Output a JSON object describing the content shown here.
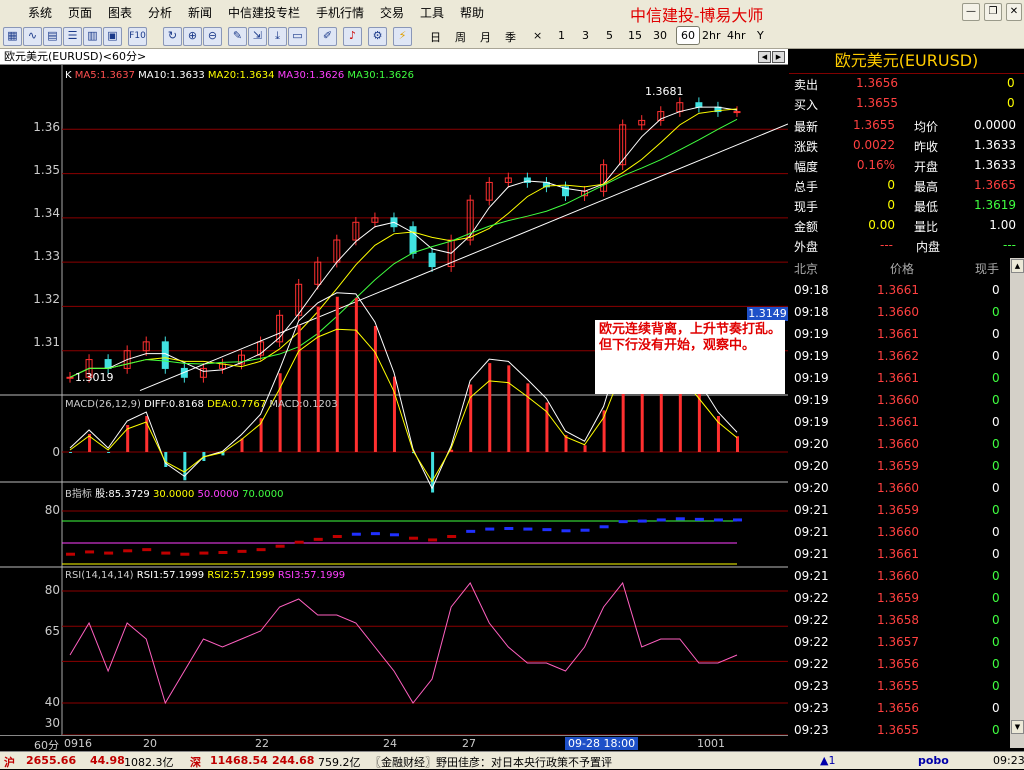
{
  "menu": [
    "系统",
    "页面",
    "图表",
    "分析",
    "新闻",
    "中信建投专栏",
    "手机行情",
    "交易",
    "工具",
    "帮助"
  ],
  "brand": "中信建投-博易大师",
  "periods": [
    "日",
    "周",
    "月",
    "季",
    "×",
    "1",
    "3",
    "5",
    "15",
    "30",
    "60",
    "2hr",
    "4hr",
    "Y"
  ],
  "selected_period": "60",
  "chart": {
    "title": "欧元美元(EURUSD)<60分>",
    "price_tag": "1.3149",
    "max_label": "1.3681",
    "min_label": "1.3019",
    "ma_legend": [
      {
        "text": "K",
        "color": "#ffffff"
      },
      {
        "text": "MA5:1.3637",
        "color": "#ff5050"
      },
      {
        "text": "MA10:1.3633",
        "color": "#ffffff"
      },
      {
        "text": "MA20:1.3634",
        "color": "#ffff00"
      },
      {
        "text": "MA30:1.3626",
        "color": "#ff40ff"
      },
      {
        "text": "MA30:1.3626",
        "color": "#40ff40"
      }
    ],
    "macd_legend": [
      {
        "text": "MACD(26,12,9)",
        "color": "#cccccc"
      },
      {
        "text": "DIFF:0.8168",
        "color": "#ffffff"
      },
      {
        "text": "DEA:0.7767",
        "color": "#ffff00"
      },
      {
        "text": "MACD:0.1203",
        "color": "#cccccc"
      }
    ],
    "b_legend": [
      {
        "text": "B指标",
        "color": "#cccccc"
      },
      {
        "text": "股:85.3729",
        "color": "#ffffff"
      },
      {
        "text": "30.0000",
        "color": "#ffff00"
      },
      {
        "text": "50.0000",
        "color": "#ff40ff"
      },
      {
        "text": "70.0000",
        "color": "#40ff40"
      }
    ],
    "rsi_legend": [
      {
        "text": "RSI(14,14,14)",
        "color": "#cccccc"
      },
      {
        "text": "RSI1:57.1999",
        "color": "#ffffff"
      },
      {
        "text": "RSI2:57.1999",
        "color": "#ffff00"
      },
      {
        "text": "RSI3:57.1999",
        "color": "#ff40ff"
      }
    ],
    "price_axis": [
      "1.36",
      "1.35",
      "1.34",
      "1.33",
      "1.32",
      "1.31"
    ],
    "macd_axis": [
      "0"
    ],
    "b_axis": [
      "80"
    ],
    "rsi_axis": [
      "80",
      "65",
      "40",
      "30"
    ],
    "note": "欧元连续背离，上升节奏打乱。但下行没有开始，观察中。",
    "x_axis": {
      "period": "60分",
      "labels": [
        "0916",
        "20",
        "22",
        "24",
        "27",
        "1001"
      ],
      "cursor": "09-28 18:00"
    }
  },
  "chart_data": {
    "type": "candlestick",
    "title": "欧元美元(EURUSD)<60分>",
    "ylim": [
      1.3,
      1.37
    ],
    "x_labels": [
      "0916",
      "20",
      "22",
      "24",
      "27",
      "1001"
    ],
    "close": [
      1.304,
      1.308,
      1.306,
      1.31,
      1.312,
      1.306,
      1.304,
      1.306,
      1.307,
      1.309,
      1.312,
      1.318,
      1.325,
      1.33,
      1.335,
      1.339,
      1.34,
      1.338,
      1.332,
      1.329,
      1.335,
      1.344,
      1.348,
      1.349,
      1.348,
      1.347,
      1.345,
      1.346,
      1.352,
      1.361,
      1.362,
      1.364,
      1.366,
      1.365,
      1.364,
      1.364
    ],
    "trendline": [
      [
        1.3019,
        1.37
      ]
    ],
    "series": [
      {
        "name": "MA5",
        "last": 1.3637
      },
      {
        "name": "MA10",
        "last": 1.3633
      },
      {
        "name": "MA20",
        "last": 1.3634
      },
      {
        "name": "MA30",
        "last": 1.3626
      }
    ],
    "macd": {
      "DIFF": 0.8168,
      "DEA": 0.7767,
      "MACD": 0.1203
    },
    "b_indicator": {
      "股": 85.3729,
      "levels": [
        30,
        50,
        70
      ]
    },
    "rsi": {
      "RSI1": 57.1999,
      "RSI2": 57.1999,
      "RSI3": 57.1999
    }
  },
  "quote": {
    "title": "欧元美元(EURUSD)",
    "sell": {
      "label": "卖出",
      "price": "1.3656",
      "qty": "0"
    },
    "buy": {
      "label": "买入",
      "price": "1.3655",
      "qty": "0"
    },
    "fields": [
      {
        "l1": "最新",
        "v1": "1.3655",
        "c1": "#ff4040",
        "l2": "均价",
        "v2": "0.0000",
        "c2": "#ffffff"
      },
      {
        "l1": "涨跌",
        "v1": "0.0022",
        "c1": "#ff4040",
        "l2": "昨收",
        "v2": "1.3633",
        "c2": "#ffffff"
      },
      {
        "l1": "幅度",
        "v1": "0.16%",
        "c1": "#ff4040",
        "l2": "开盘",
        "v2": "1.3633",
        "c2": "#ffffff"
      },
      {
        "l1": "总手",
        "v1": "0",
        "c1": "#ffff00",
        "l2": "最高",
        "v2": "1.3665",
        "c2": "#ff4040"
      },
      {
        "l1": "现手",
        "v1": "0",
        "c1": "#ffff00",
        "l2": "最低",
        "v2": "1.3619",
        "c2": "#40ff40"
      },
      {
        "l1": "金额",
        "v1": "0.00",
        "c1": "#ffff00",
        "l2": "量比",
        "v2": "1.00",
        "c2": "#ffffff"
      }
    ],
    "outer": {
      "label": "外盘",
      "value": "---"
    },
    "inner": {
      "label": "内盘",
      "value": "---"
    },
    "trade_headers": [
      "北京",
      "价格",
      "现手"
    ],
    "trades": [
      {
        "time": "09:18",
        "price": "1.3661",
        "qty": "0",
        "qc": "#ffffff"
      },
      {
        "time": "09:18",
        "price": "1.3660",
        "qty": "0",
        "qc": "#40ff40"
      },
      {
        "time": "09:19",
        "price": "1.3661",
        "qty": "0",
        "qc": "#ffffff"
      },
      {
        "time": "09:19",
        "price": "1.3662",
        "qty": "0",
        "qc": "#ffffff"
      },
      {
        "time": "09:19",
        "price": "1.3661",
        "qty": "0",
        "qc": "#40ff40"
      },
      {
        "time": "09:19",
        "price": "1.3660",
        "qty": "0",
        "qc": "#40ff40"
      },
      {
        "time": "09:19",
        "price": "1.3661",
        "qty": "0",
        "qc": "#ffffff"
      },
      {
        "time": "09:20",
        "price": "1.3660",
        "qty": "0",
        "qc": "#40ff40"
      },
      {
        "time": "09:20",
        "price": "1.3659",
        "qty": "0",
        "qc": "#40ff40"
      },
      {
        "time": "09:20",
        "price": "1.3660",
        "qty": "0",
        "qc": "#ffffff"
      },
      {
        "time": "09:21",
        "price": "1.3659",
        "qty": "0",
        "qc": "#40ff40"
      },
      {
        "time": "09:21",
        "price": "1.3660",
        "qty": "0",
        "qc": "#ffffff"
      },
      {
        "time": "09:21",
        "price": "1.3661",
        "qty": "0",
        "qc": "#ffffff"
      },
      {
        "time": "09:21",
        "price": "1.3660",
        "qty": "0",
        "qc": "#40ff40"
      },
      {
        "time": "09:22",
        "price": "1.3659",
        "qty": "0",
        "qc": "#40ff40"
      },
      {
        "time": "09:22",
        "price": "1.3658",
        "qty": "0",
        "qc": "#40ff40"
      },
      {
        "time": "09:22",
        "price": "1.3657",
        "qty": "0",
        "qc": "#40ff40"
      },
      {
        "time": "09:22",
        "price": "1.3656",
        "qty": "0",
        "qc": "#40ff40"
      },
      {
        "time": "09:23",
        "price": "1.3655",
        "qty": "0",
        "qc": "#40ff40"
      },
      {
        "time": "09:23",
        "price": "1.3656",
        "qty": "0",
        "qc": "#ffffff"
      },
      {
        "time": "09:23",
        "price": "1.3655",
        "qty": "0",
        "qc": "#40ff40"
      }
    ]
  },
  "status": {
    "sh_label": "沪",
    "sh_index": "2655.66",
    "sh_change": "44.98",
    "sh_amount": "1082.3亿",
    "sz_label": "深",
    "sz_index": "11468.54",
    "sz_change": "244.68",
    "sz_amount": "759.2亿",
    "news": "〖金融财经〗野田佳彦：对日本央行政策不予置评",
    "alert": "▲1",
    "logo": "pobo",
    "time": "09:23"
  },
  "colors": {
    "up": "#ff3030",
    "down": "#40e0e0",
    "ma10": "#ffffff",
    "ma20": "#ffff00",
    "ma30": "#40ff40",
    "grid": "#8b0000"
  }
}
